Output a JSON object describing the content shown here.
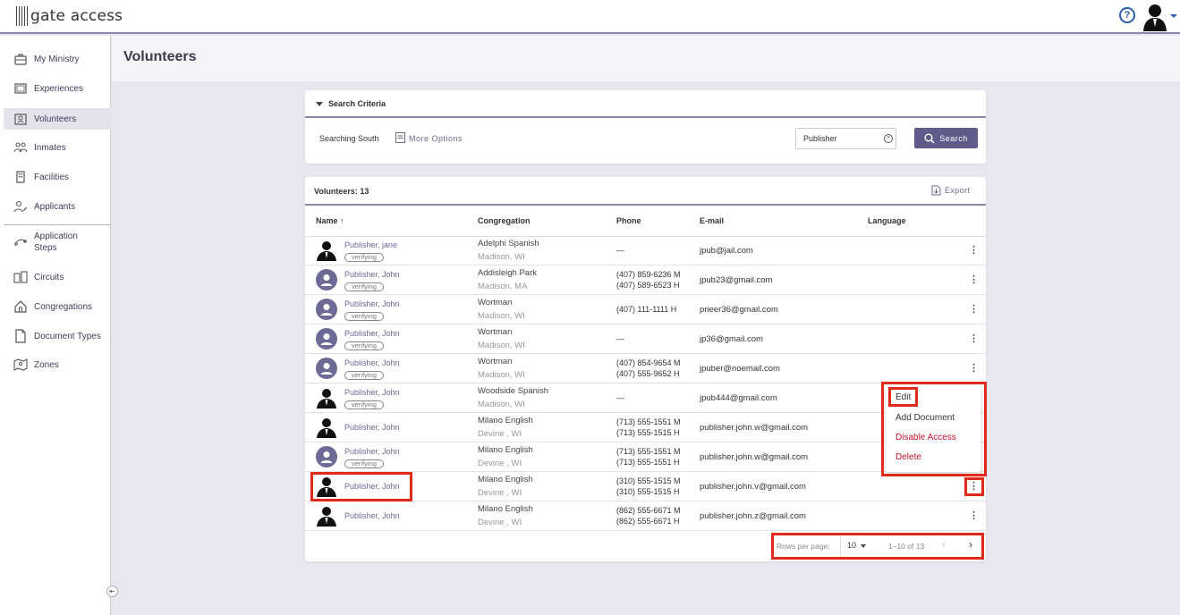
{
  "app": {
    "logo_text": "gate access",
    "help_label": "?"
  },
  "sidebar": {
    "items": [
      {
        "label": "My Ministry",
        "icon": "briefcase-icon"
      },
      {
        "label": "Experiences",
        "icon": "gallery-icon"
      },
      {
        "label": "Volunteers",
        "icon": "volunteer-badge-icon"
      },
      {
        "label": "Inmates",
        "icon": "people-icon"
      },
      {
        "label": "Facilities",
        "icon": "building-icon"
      },
      {
        "label": "Applicants",
        "icon": "person-edit-icon"
      },
      {
        "label": "Application Steps",
        "icon": "steps-icon"
      },
      {
        "label": "Circuits",
        "icon": "circuit-icon"
      },
      {
        "label": "Congregations",
        "icon": "house-icon"
      },
      {
        "label": "Document Types",
        "icon": "document-icon"
      },
      {
        "label": "Zones",
        "icon": "map-icon"
      }
    ],
    "collapse_label": "⇤"
  },
  "page": {
    "title": "Volunteers"
  },
  "search": {
    "section_title": "Search Criteria",
    "searching_text": "Searching South",
    "more_options": "More Options",
    "input_value": "Publisher",
    "button_label": "Search"
  },
  "table": {
    "count_label": "Volunteers: 13",
    "export_label": "Export",
    "columns": {
      "name": "Name ↑",
      "congregation": "Congregation",
      "phone": "Phone",
      "email": "E-mail",
      "language": "Language"
    },
    "rows": [
      {
        "name": "Publisher, jane",
        "badge": "verifying",
        "avatar": "photo",
        "cong": "Adelphi Spanish",
        "city": "Madison, WI",
        "phone1": "—",
        "phone2": "",
        "email": "jpub@jail.com"
      },
      {
        "name": "Publisher, John",
        "badge": "verifying",
        "avatar": "default",
        "cong": "Addisleigh Park",
        "city": "Madison, MA",
        "phone1": "(407) 859-6236 M",
        "phone2": "(407) 589-6523 H",
        "email": "jpub23@gmail.com"
      },
      {
        "name": "Publisher, John",
        "badge": "verifying",
        "avatar": "default",
        "cong": "Wortman",
        "city": "Madison, WI",
        "phone1": "(407) 111-1111 H",
        "phone2": "",
        "email": "prieer36@gmail.com"
      },
      {
        "name": "Publisher, John",
        "badge": "verifying",
        "avatar": "default",
        "cong": "Wortman",
        "city": "Madison, WI",
        "phone1": "—",
        "phone2": "",
        "email": "jp36@gmail.com"
      },
      {
        "name": "Publisher, John",
        "badge": "verifying",
        "avatar": "default",
        "cong": "Wortman",
        "city": "Madison, WI",
        "phone1": "(407) 854-9654 M",
        "phone2": "(407) 555-9652 H",
        "email": "jpuber@noemail.com"
      },
      {
        "name": "Publisher, John",
        "badge": "verifying",
        "avatar": "photo",
        "cong": "Woodside Spanish",
        "city": "Madison, WI",
        "phone1": "—",
        "phone2": "",
        "email": "jpub444@gmail.com"
      },
      {
        "name": "Publisher, John",
        "badge": "",
        "avatar": "photo",
        "cong": "Milano English",
        "city": "Devine , WI",
        "phone1": "(713) 555-1551 M",
        "phone2": "(713) 555-1515 H",
        "email": "publisher.john.w@gmail.com"
      },
      {
        "name": "Publisher, John",
        "badge": "verifying",
        "avatar": "default",
        "cong": "Milano English",
        "city": "Devine , WI",
        "phone1": "(713) 555-1551 M",
        "phone2": "(713) 555-1551 H",
        "email": "publisher.john.w@gmail.com"
      },
      {
        "name": "Publisher, John",
        "badge": "",
        "avatar": "photo",
        "cong": "Milano English",
        "city": "Devine , WI",
        "phone1": "(310) 555-1515 M",
        "phone2": "(310) 555-1515 H",
        "email": "publisher.john.v@gmail.com"
      },
      {
        "name": "Publisher, John",
        "badge": "",
        "avatar": "photo",
        "cong": "Milano English",
        "city": "Devine , WI",
        "phone1": "(862) 555-6671 M",
        "phone2": "(862) 555-6671 H",
        "email": "publisher.john.z@gmail.com"
      }
    ]
  },
  "pagination": {
    "rows_per_page_label": "Rows per page:",
    "rows_per_page": "10",
    "range": "1–10 of 13"
  },
  "context_menu": {
    "items": [
      {
        "label": "Edit",
        "color": "#333333"
      },
      {
        "label": "Add Document",
        "color": "#333333"
      },
      {
        "label": "Disable Access",
        "color": "#c8102e"
      },
      {
        "label": "Delete",
        "color": "#c8102e"
      }
    ]
  },
  "colors": {
    "accent": "#5f5b8a",
    "link": "#6b6a9a",
    "danger": "#c8102e",
    "highlight": "#e02a1a"
  }
}
